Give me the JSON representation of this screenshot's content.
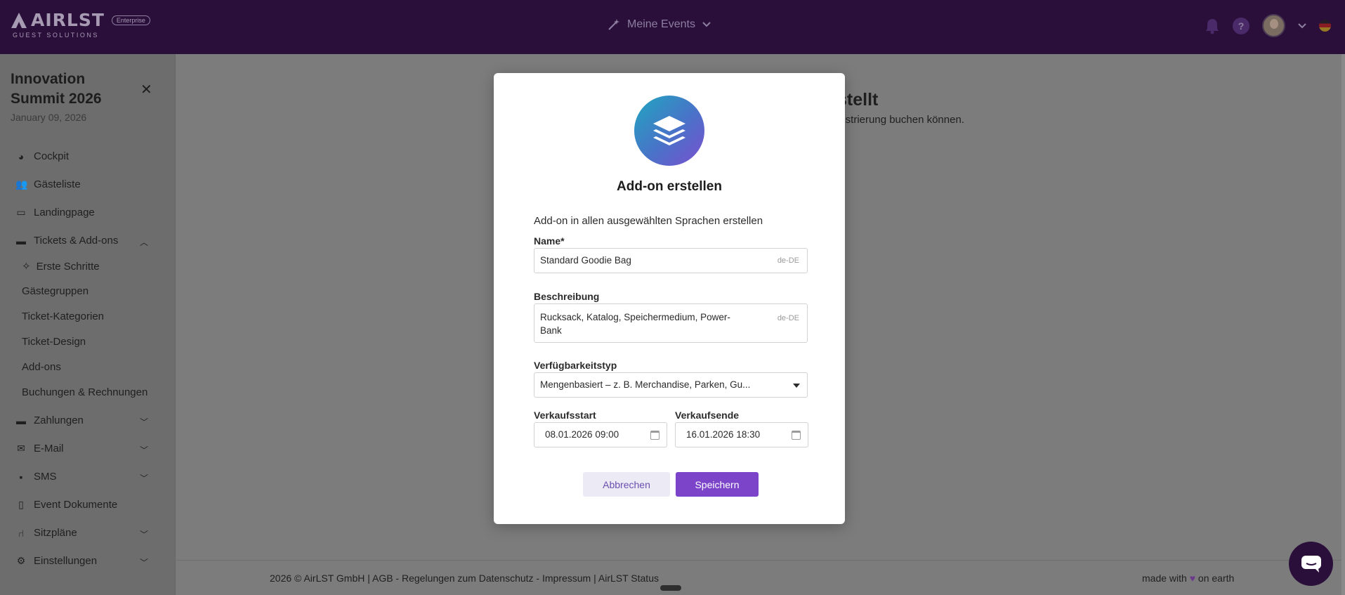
{
  "app": {
    "logo_text": "AIRLST",
    "logo_sub": "GUEST SOLUTIONS",
    "edition_badge": "Enterprise",
    "events_menu_label": "Meine Events",
    "help_label": "?"
  },
  "sidebar": {
    "event_title": "Innovation Summit 2026",
    "event_date": "January 09, 2026",
    "items": [
      {
        "label": "Cockpit",
        "icon": "chart-pie-icon"
      },
      {
        "label": "Gästeliste",
        "icon": "users-icon"
      },
      {
        "label": "Landingpage",
        "icon": "window-icon"
      },
      {
        "label": "Tickets & Add-ons",
        "icon": "ticket-icon",
        "expanded": true
      },
      {
        "label": "Zahlungen",
        "icon": "credit-card-icon"
      },
      {
        "label": "E-Mail",
        "icon": "mail-icon"
      },
      {
        "label": "SMS",
        "icon": "message-icon"
      },
      {
        "label": "Event Dokumente",
        "icon": "document-icon"
      },
      {
        "label": "Sitzpläne",
        "icon": "seat-icon"
      },
      {
        "label": "Einstellungen",
        "icon": "gear-icon"
      }
    ],
    "sub_items": [
      {
        "label": "Erste Schritte",
        "icon": "sparkles-icon"
      },
      {
        "label": "Gästegruppen"
      },
      {
        "label": "Ticket-Kategorien"
      },
      {
        "label": "Ticket-Design"
      },
      {
        "label": "Add-ons"
      },
      {
        "label": "Buchungen & Rechnungen"
      }
    ]
  },
  "background": {
    "heading_fragment": "stellt",
    "text_fragment": "gistrierung buchen können."
  },
  "modal": {
    "title": "Add-on erstellen",
    "subtitle": "Add-on in allen ausgewählten Sprachen erstellen",
    "name_label": "Name*",
    "name_value": "Standard Goodie Bag",
    "name_lang": "de-DE",
    "desc_label": "Beschreibung",
    "desc_value": "Rucksack, Katalog, Speichermedium, Power-Bank",
    "desc_lang": "de-DE",
    "availability_label": "Verfügbarkeitstyp",
    "availability_value": "Mengenbasiert – z. B. Merchandise, Parken, Gu...",
    "sale_start_label": "Verkaufsstart",
    "sale_start_value": "08.01.2026 09:00",
    "sale_end_label": "Verkaufsende",
    "sale_end_value": "16.01.2026 18:30",
    "cancel_label": "Abbrechen",
    "save_label": "Speichern",
    "accent_color": "#7b44c9"
  },
  "footer": {
    "left_text": "2026 © AirLST GmbH | AGB - Regelungen zum Datenschutz - Impressum | AirLST Status",
    "right_text_before": "made with",
    "right_text_after": "on earth"
  }
}
